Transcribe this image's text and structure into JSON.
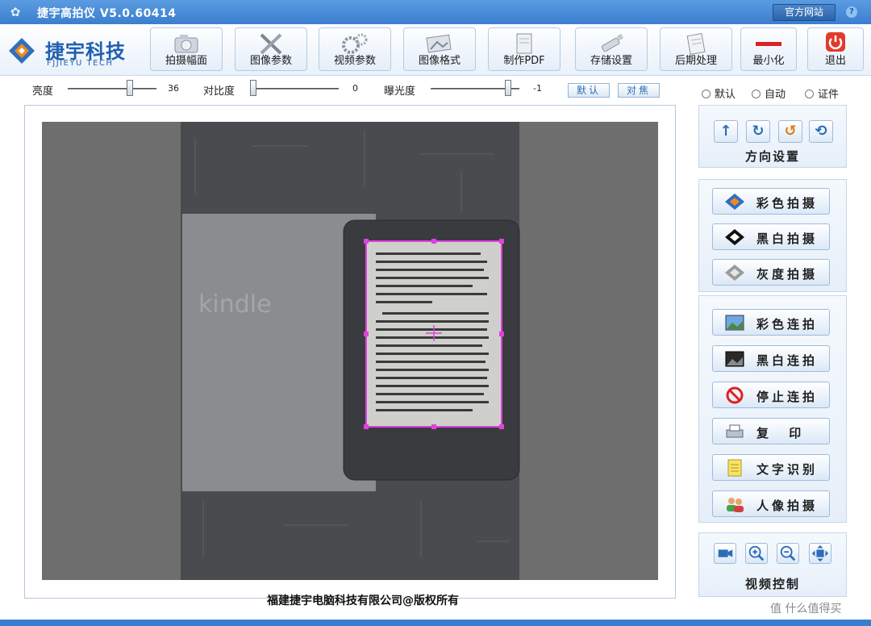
{
  "window": {
    "title": "捷宇高拍仪 V5.0.60414",
    "website_button": "官方网站",
    "help_button": "?"
  },
  "logo": {
    "name": "捷宇科技",
    "subtitle": "FJJIEYU TECH",
    "mark_letter": "R"
  },
  "toolbar": {
    "items": [
      {
        "label": "拍摄幅面",
        "icon": "camera-icon"
      },
      {
        "label": "图像参数",
        "icon": "tools-icon"
      },
      {
        "label": "视频参数",
        "icon": "gears-icon"
      },
      {
        "label": "图像格式",
        "icon": "image-format-icon"
      },
      {
        "label": "制作PDF",
        "icon": "pdf-icon"
      },
      {
        "label": "存储设置",
        "icon": "usb-drive-icon"
      },
      {
        "label": "后期处理",
        "icon": "notepad-icon"
      },
      {
        "label": "最小化",
        "icon": "minimize-icon"
      },
      {
        "label": "退出",
        "icon": "power-icon"
      }
    ]
  },
  "sliders": {
    "brightness": {
      "label": "亮度",
      "value": "36",
      "level": 0.72
    },
    "contrast": {
      "label": "对比度",
      "value": "0",
      "level": 0.0
    },
    "exposure": {
      "label": "曝光度",
      "value": "-1",
      "level": 0.9
    },
    "default_button": "默认",
    "focus_button": "对焦"
  },
  "mode_radios": [
    {
      "label": "默认",
      "selected": false
    },
    {
      "label": "自动",
      "selected": false
    },
    {
      "label": "证件",
      "selected": false
    }
  ],
  "direction_panel": {
    "title": "方向设置",
    "buttons": [
      "arrow-up-icon",
      "rotate-right-icon",
      "rotate-left-icon",
      "refresh-icon"
    ]
  },
  "capture_buttons": [
    {
      "label": "彩色拍摄",
      "icon": "color-capture-icon"
    },
    {
      "label": "黑白拍摄",
      "icon": "bw-capture-icon"
    },
    {
      "label": "灰度拍摄",
      "icon": "gray-capture-icon"
    }
  ],
  "continuous_buttons": [
    {
      "label": "彩色连拍",
      "icon": "color-burst-icon"
    },
    {
      "label": "黑白连拍",
      "icon": "bw-burst-icon"
    },
    {
      "label": "停止连拍",
      "icon": "stop-icon"
    },
    {
      "label": "复 印",
      "icon": "printer-icon"
    },
    {
      "label": "文字识别",
      "icon": "ocr-document-icon"
    },
    {
      "label": "人像拍摄",
      "icon": "people-icon"
    }
  ],
  "video_panel": {
    "title": "视频控制",
    "buttons": [
      "video-camera-icon",
      "zoom-in-icon",
      "zoom-out-icon",
      "fit-screen-icon"
    ]
  },
  "preview": {
    "device_brand": "kindle"
  },
  "footer": {
    "copyright": "福建捷宇电脑科技有限公司@版权所有",
    "watermark": "值 什么值得买"
  },
  "colors": {
    "titlebar": "#3a7fcf",
    "accent": "#1f5fae",
    "crop_box": "#e040e0",
    "preview_bg": "#6e6e6e"
  }
}
